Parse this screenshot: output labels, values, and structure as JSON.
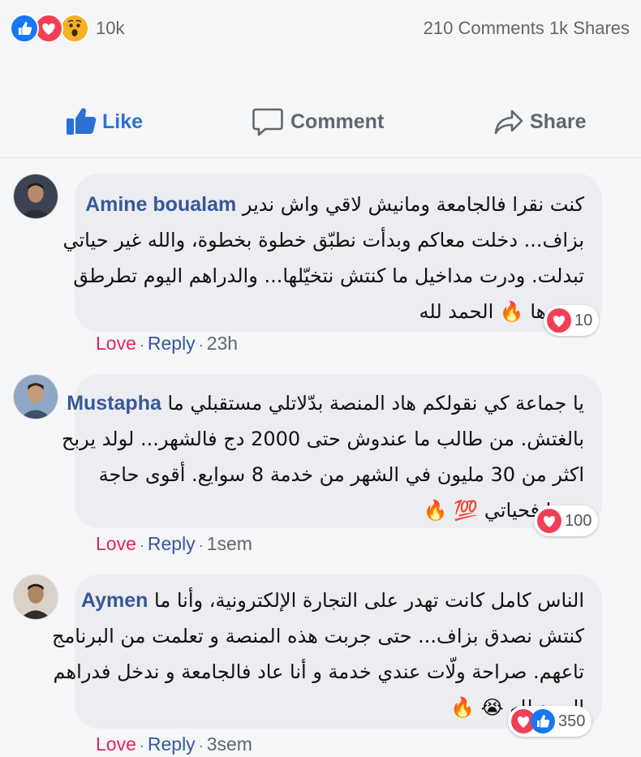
{
  "summary": {
    "reaction_count": "10k",
    "comments_shares": "210 Comments 1k Shares",
    "reaction_icons": [
      "like-icon",
      "love-icon",
      "wow-icon"
    ]
  },
  "actions": {
    "like": "Like",
    "comment": "Comment",
    "share": "Share"
  },
  "colors": {
    "like_blue": "#2d6fd9",
    "author_blue": "#385898",
    "love_red": "#e0245e",
    "bubble_bg": "#ebedf0"
  },
  "comments": [
    {
      "author": "Amine boualam",
      "lines": [
        "كنت نقرا فالجامعة ومانيش لاقي واش ندير",
        "بزاف... دخلت معاكم وبدأت نطبّق خطوة بخطوة، والله غير حياتي",
        "تبدلت. ودرت مداخيل ما كنتش نتخيّلها... والدراهم اليوم تطرطق",
        ".وحدها 🔥 الحمد لله"
      ],
      "reaction_count": "10",
      "love_label": "Love",
      "reply_label": "Reply",
      "time": "23h"
    },
    {
      "author": "Mustapha",
      "lines": [
        "يا جماعة كي نقولكم هاد المنصة بدّلاتلي مستقبلي ما",
        "بالغتش. من طالب ما عندوش حتى 2000 دج فالشهر... لولد يربح",
        "اكثر من 30 مليون في الشهر من خدمة 8 سوايع. أقوى حاجة",
        "درتها فحياتي 💯 🔥"
      ],
      "reaction_count": "100",
      "love_label": "Love",
      "reply_label": "Reply",
      "time": "1sem"
    },
    {
      "author": "Aymen",
      "lines": [
        "الناس كامل كانت تهدر على التجارة الإلكترونية، وأنا ما",
        "كنتش نصدق بزاف... حتى جربت هذه المنصة و تعلمت من البرنامج",
        "تاعهم. صراحة ولّات عندي خدمة و أنا عاد فالجامعة و ندخل فدراهم",
        "الحمد لله 😭 🔥"
      ],
      "reaction_count": "350",
      "love_label": "Love",
      "reply_label": "Reply",
      "time": "3sem"
    }
  ]
}
